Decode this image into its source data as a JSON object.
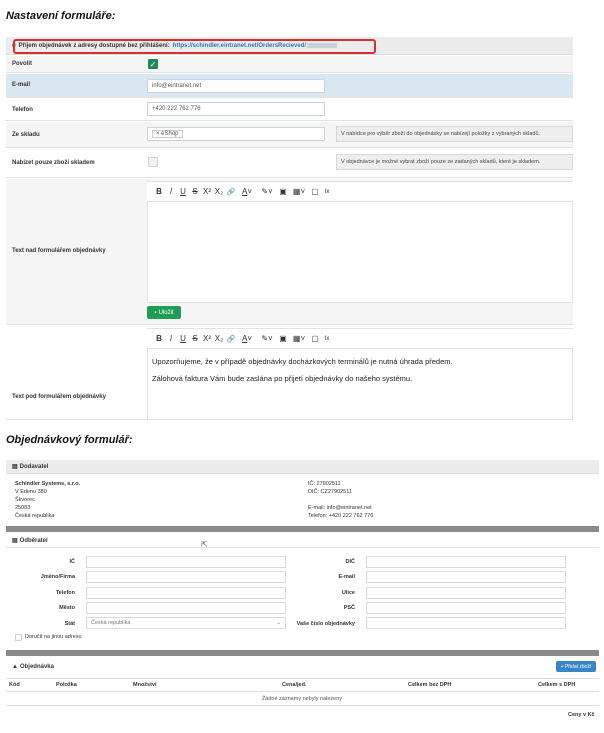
{
  "settings": {
    "heading": "Nastavení formuláře:",
    "url_row": {
      "label": "Příjem objednávek z adresy dostupné bez přihlášení:",
      "url": "https://schindler.eintranet.net/OrdersRecieved/"
    },
    "fields": {
      "povolit": {
        "label": "Povolit",
        "checked": true
      },
      "email": {
        "label": "E-mail",
        "value": "info@eintranet.net"
      },
      "telefon": {
        "label": "Telefon",
        "value": "+420 222 762 776"
      },
      "ze_skladu": {
        "label": "Ze skladu",
        "tag": "× eShop",
        "help": "V nabídce pro výběr zboží do objednávky se nabízejí položky z vybraných skladů."
      },
      "nabizet": {
        "label": "Nabízet pouze zboží skladem",
        "checked": false,
        "help": "V objednávce je možné vybrat zboží pouze ze zadaných skladů, které je skladem."
      },
      "text_nad": {
        "label": "Text nad formulářem objednávky"
      },
      "text_pod": {
        "label": "Text pod formulářem objednávky",
        "lines": [
          "Upozorňujeme, že v případě objednávky docházkových terminálů je nutná úhrada předem.",
          "Zálohová faktura Vám bude zaslána po přijetí objednávky do našeho systému."
        ]
      }
    },
    "toolbar": {
      "bold": "B",
      "italic": "I",
      "underline": "U",
      "strike": "S",
      "sup": "X²",
      "sub": "X₂",
      "link": "🔗",
      "font_color": "A",
      "highlight": "✎",
      "image": "▣",
      "table": "▦",
      "embed": "▢",
      "clear": "Ix"
    },
    "save_button": "Uložit"
  },
  "order_form": {
    "heading": "Objednávkový formulář:",
    "dodavatel": {
      "title": "Dodavatel",
      "left": [
        "Schindler Systems, s.r.o.",
        "V Edenu 380",
        "Škvorec",
        "25083",
        "Česká republika"
      ],
      "right": [
        "IČ: 27902511",
        "DIČ: CZ27902511",
        "",
        "E-mail: info@eintranet.net",
        "Telefon: +420 222 762 776"
      ]
    },
    "odberatel": {
      "title": "Odběratel",
      "left_labels": [
        "IČ",
        "Jméno/Firma",
        "Telefon",
        "Město",
        "Stát"
      ],
      "right_labels": [
        "DIČ",
        "E-mail",
        "Ulice",
        "PSČ",
        "Vaše číslo objednávky"
      ],
      "country_value": "Česká republika",
      "deliver_other": "Doručit na jinou adresu"
    },
    "objednavka": {
      "title": "Objednávka",
      "add_button": "+ Přidat zboží",
      "columns": [
        "Kód",
        "Položka",
        "Množství",
        "Cena/jed.",
        "Celkem bez DPH",
        "Celkem s DPH"
      ],
      "empty": "Žádné záznamy nebyly nalezeny",
      "footer": "Ceny v Kč"
    }
  }
}
